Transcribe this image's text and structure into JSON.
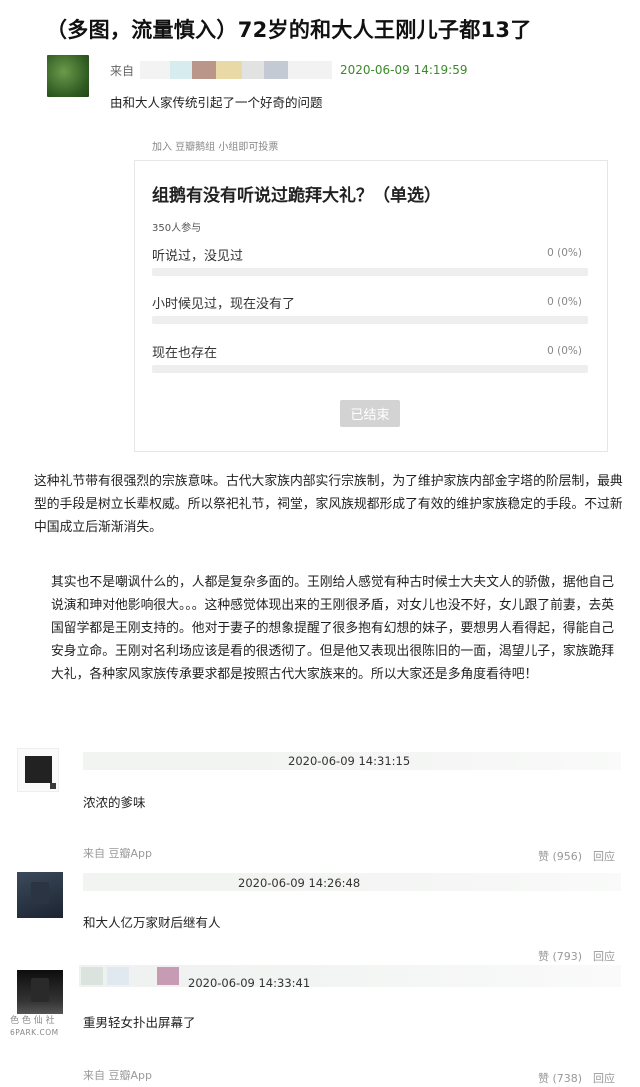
{
  "post": {
    "title": "（多图，流量慎入）72岁的和大人王刚儿子都13了",
    "from_label": "来自",
    "time": "2020-06-09 14:19:59",
    "intro": "由和大人家传统引起了一个好奇的问题"
  },
  "poll": {
    "hint": "加入 豆瓣鹅组 小组即可投票",
    "question": "组鹅有没有听说过跪拜大礼？（单选）",
    "participants": "350人参与",
    "options": [
      {
        "label": "听说过，没见过",
        "value": "0 (0%)",
        "fraction": 0
      },
      {
        "label": "小时候见过，现在没有了",
        "value": "0 (0%)",
        "fraction": 0
      },
      {
        "label": "现在也存在",
        "value": "0 (0%)",
        "fraction": 0
      }
    ],
    "button": "已结束"
  },
  "body": {
    "para1": "这种礼节带有很强烈的宗族意味。古代大家族内部实行宗族制，为了维护家族内部金字塔的阶层制，最典型的手段是树立长辈权威。所以祭祀礼节，祠堂，家风族规都形成了有效的维护家族稳定的手段。不过新中国成立后渐渐消失。",
    "para2": "其实也不是嘲讽什么的，人都是复杂多面的。王刚给人感觉有种古时候士大夫文人的骄傲，据他自己说演和珅对他影响很大。。。这种感觉体现出来的王刚很矛盾，对女儿也没不好，女儿跟了前妻，去英国留学都是王刚支持的。他对于妻子的想象提醒了很多抱有幻想的妹子，要想男人看得起，得能自己安身立命。王刚对名利场应该是看的很透彻了。但是他又表现出很陈旧的一面，渴望儿子，家族跪拜大礼，各种家风家族传承要求都是按照古代大家族来的。所以大家还是多角度看待吧！"
  },
  "comments": [
    {
      "time": "2020-06-09 14:31:15",
      "text": "浓浓的爹味",
      "from": "来自 豆瓣App",
      "likes": "赞 (956)",
      "reply": "回应"
    },
    {
      "time": "2020-06-09 14:26:48",
      "text": "和大人亿万家财后继有人",
      "from": "",
      "likes": "赞 (793)",
      "reply": "回应"
    },
    {
      "time": "2020-06-09 14:33:41",
      "text": "重男轻女扑出屏幕了",
      "from": "来自 豆瓣App",
      "likes": "赞 (738)",
      "reply": "回应"
    }
  ],
  "watermark": {
    "line1": "色 色 仙 社",
    "line2": "6PARK.COM"
  },
  "colors": {
    "time_green": "#3a8a2a",
    "poll_bar": "#eeeeee",
    "button_gray": "#d3d3d3"
  }
}
